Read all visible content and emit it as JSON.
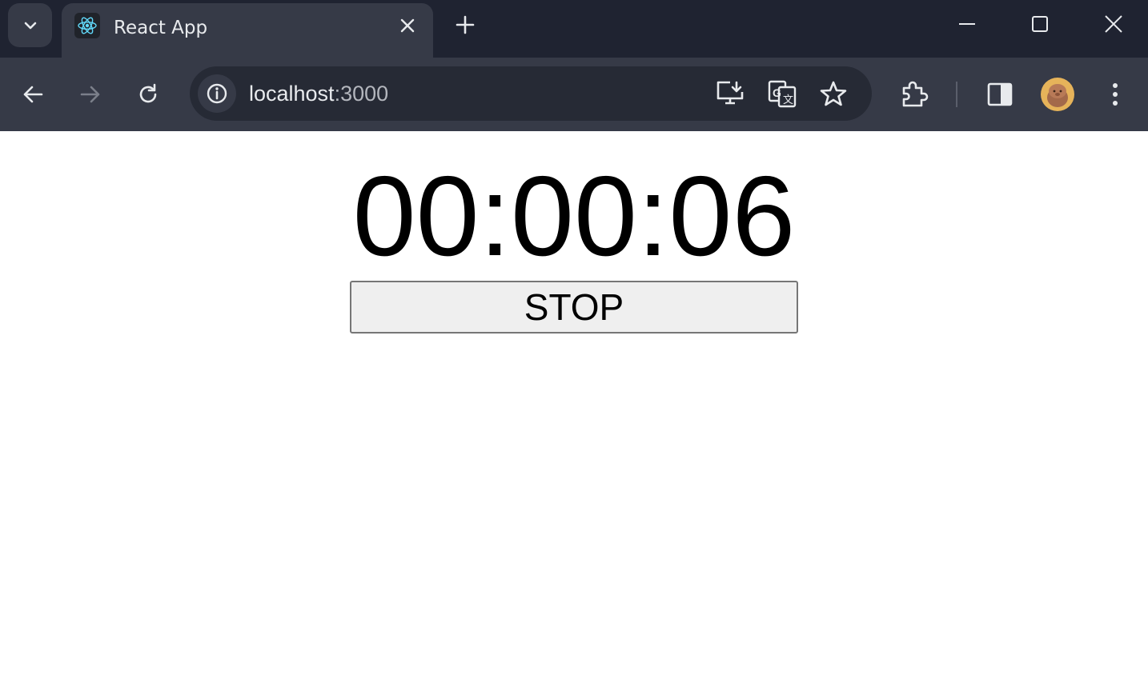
{
  "browser": {
    "tab": {
      "title": "React App",
      "favicon": "react-logo-icon"
    },
    "address_bar": {
      "host": "localhost",
      "port": ":3000"
    },
    "icons": {
      "tab_search": "chevron-down-icon",
      "close_tab": "close-icon",
      "new_tab": "plus-icon",
      "minimize": "minimize-icon",
      "maximize": "maximize-icon",
      "close_window": "close-window-icon",
      "back": "arrow-left-icon",
      "forward": "arrow-right-icon",
      "reload": "reload-icon",
      "site_info": "info-icon",
      "install": "install-app-icon",
      "translate": "translate-icon",
      "bookmark": "star-icon",
      "extensions": "puzzle-icon",
      "side_panel": "side-panel-icon",
      "profile": "avatar",
      "menu": "more-vertical-icon"
    },
    "colors": {
      "tabstrip": "#1f2331",
      "toolbar": "#363a47",
      "omnibox": "#262a35"
    }
  },
  "page": {
    "timer": "00:00:06",
    "stop_label": "STOP"
  }
}
